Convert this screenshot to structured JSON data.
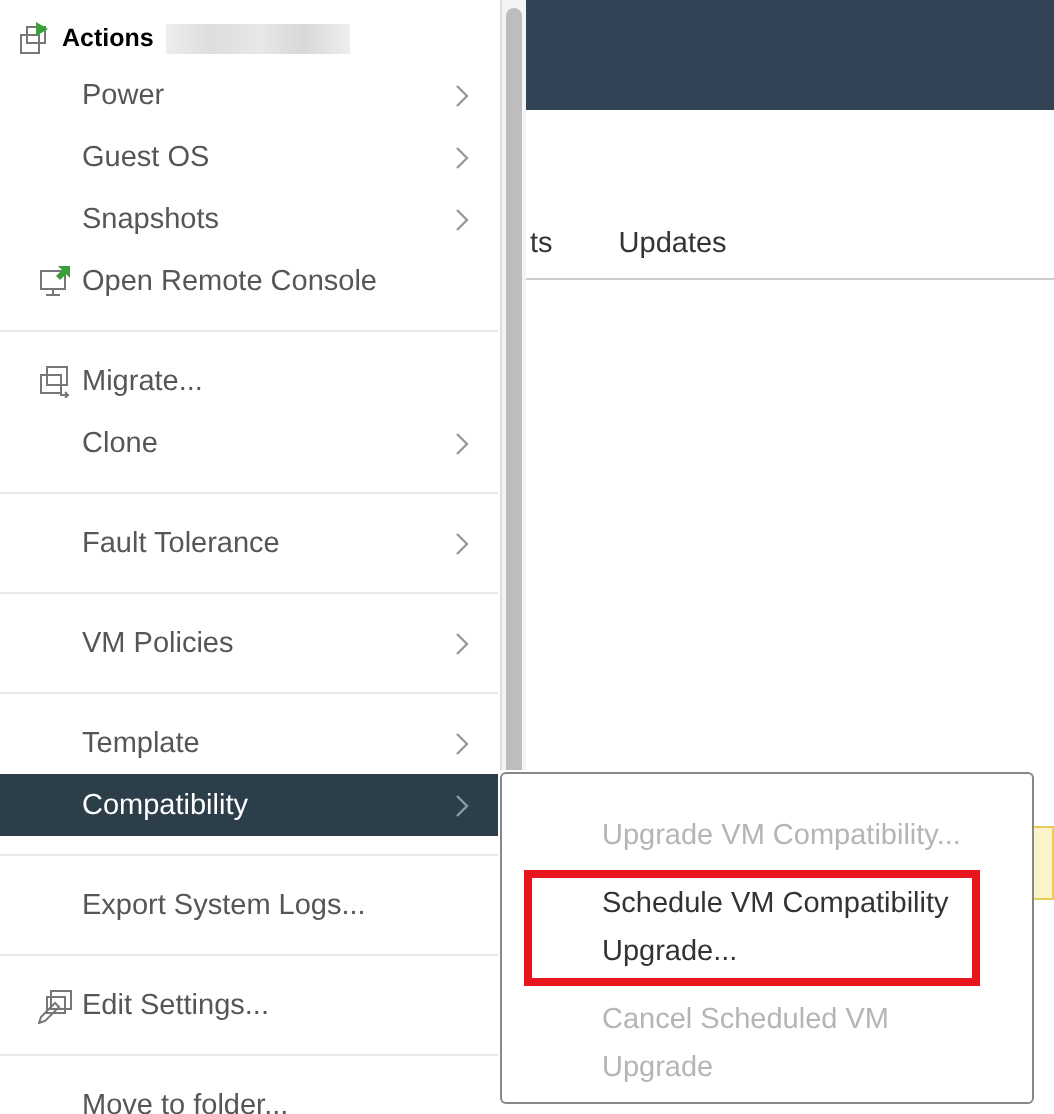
{
  "background": {
    "tabs": [
      {
        "label": "ts",
        "selected": false
      },
      {
        "label": "Updates",
        "selected": false
      }
    ]
  },
  "menu": {
    "title": "Actions",
    "groups": [
      [
        {
          "label": "Power",
          "kind": "plain",
          "submenu": true,
          "selected": false
        },
        {
          "label": "Guest OS",
          "kind": "plain",
          "submenu": true,
          "selected": false
        },
        {
          "label": "Snapshots",
          "kind": "plain",
          "submenu": true,
          "selected": false
        },
        {
          "label": "Open Remote Console",
          "kind": "console",
          "submenu": false,
          "selected": false
        }
      ],
      [
        {
          "label": "Migrate...",
          "kind": "migrate",
          "submenu": false,
          "selected": false
        },
        {
          "label": "Clone",
          "kind": "plain",
          "submenu": true,
          "selected": false
        }
      ],
      [
        {
          "label": "Fault Tolerance",
          "kind": "plain",
          "submenu": true,
          "selected": false
        }
      ],
      [
        {
          "label": "VM Policies",
          "kind": "plain",
          "submenu": true,
          "selected": false
        }
      ],
      [
        {
          "label": "Template",
          "kind": "plain",
          "submenu": true,
          "selected": false
        },
        {
          "label": "Compatibility",
          "kind": "plain",
          "submenu": true,
          "selected": true
        }
      ],
      [
        {
          "label": "Export System Logs...",
          "kind": "plain",
          "submenu": false,
          "selected": false
        }
      ],
      [
        {
          "label": "Edit Settings...",
          "kind": "settings",
          "submenu": false,
          "selected": false
        }
      ],
      [
        {
          "label": "Move to folder...",
          "kind": "plain",
          "submenu": false,
          "selected": false
        }
      ]
    ]
  },
  "submenu": {
    "items": [
      {
        "label": "Upgrade VM Compatibility...",
        "disabled": true,
        "outlined": false
      },
      {
        "label": "Schedule VM Compatibility Upgrade...",
        "disabled": false,
        "outlined": true
      },
      {
        "label": "Cancel Scheduled VM Upgrade",
        "disabled": true,
        "outlined": false
      }
    ]
  }
}
